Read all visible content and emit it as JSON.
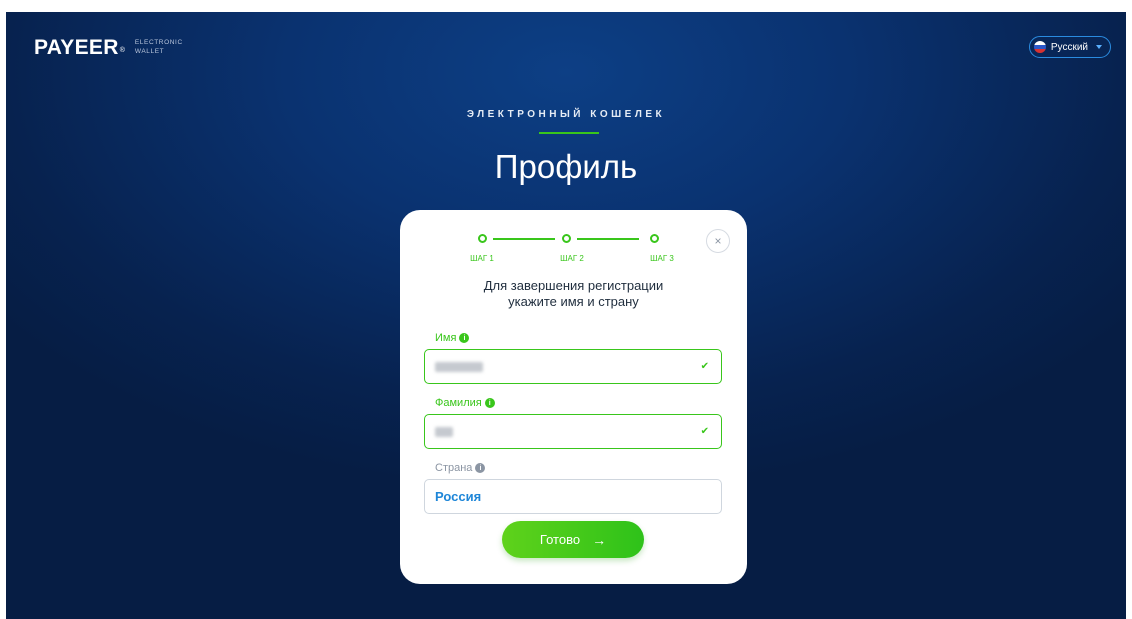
{
  "header": {
    "logo": "PAYEER",
    "logo_reg": "®",
    "logo_sub1": "ELECTRONIC",
    "logo_sub2": "WALLET",
    "language": "Русский"
  },
  "hero": {
    "eyebrow": "ЭЛЕКТРОННЫЙ КОШЕЛЕК",
    "title": "Профиль"
  },
  "card": {
    "close_glyph": "×",
    "steps": [
      "ШАГ 1",
      "ШАГ 2",
      "ШАГ 3"
    ],
    "prompt_line1": "Для завершения регистрации",
    "prompt_line2": "укажите имя и страну",
    "fields": {
      "first_name_label": "Имя",
      "last_name_label": "Фамилия",
      "country_label": "Страна",
      "country_value": "Россия"
    },
    "submit_label": "Готово",
    "submit_arrow": "→"
  },
  "colors": {
    "accent_green": "#39c61b",
    "link_blue": "#1e86d8",
    "background_navy": "#0a3270"
  },
  "icons": [
    "russia-flag-icon",
    "caret-down-icon",
    "close-icon",
    "info-icon",
    "check-icon",
    "arrow-right-icon"
  ]
}
